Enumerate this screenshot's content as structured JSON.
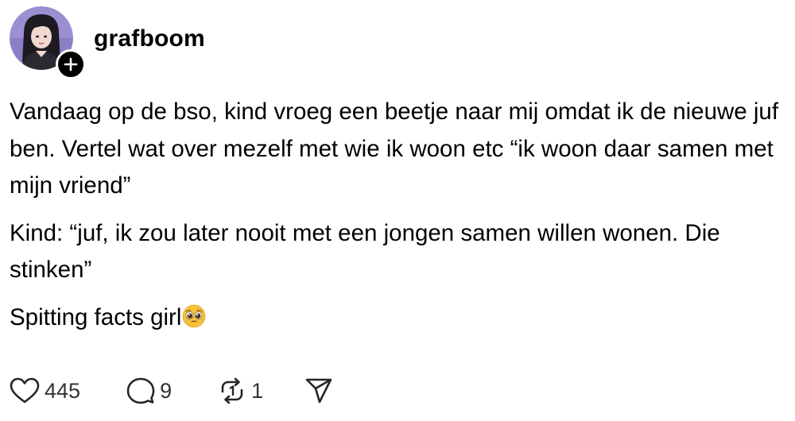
{
  "post": {
    "username": "grafboom",
    "avatar_icon": "profile-avatar",
    "follow_icon": "plus-icon",
    "paragraphs": [
      "Vandaag op de bso, kind vroeg een beetje naar mij omdat ik de nieuwe juf ben. Vertel wat over mezelf met wie ik woon etc “ik woon daar samen met mijn vriend”",
      "Kind: “juf, ik zou later nooit met een jongen samen willen wonen. Die stinken”",
      "Spitting facts girl"
    ],
    "emoji": "pleading-face-emoji"
  },
  "actions": {
    "likes": "445",
    "replies": "9",
    "reposts": "1",
    "icons": [
      "heart-icon",
      "comment-icon",
      "repost-icon",
      "share-icon"
    ]
  },
  "colors": {
    "text": "#000000",
    "icon": "#262626",
    "background": "#ffffff"
  }
}
